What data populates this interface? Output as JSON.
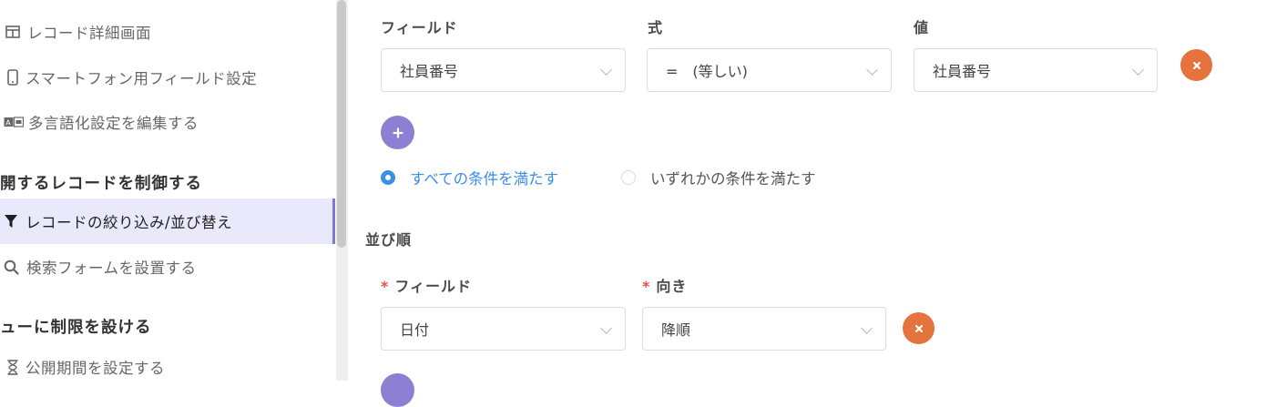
{
  "sidebar": {
    "items": [
      {
        "label": "レコード詳細画面",
        "icon": "columns-icon"
      },
      {
        "label": "スマートフォン用フィールド設定",
        "icon": "smartphone-icon"
      },
      {
        "label": "多言語化設定を編集する",
        "icon": "translate-icon"
      }
    ],
    "section1": "開するレコードを制御する",
    "section1_items": [
      {
        "label": "レコードの絞り込み/並び替え",
        "icon": "filter-icon",
        "active": true
      },
      {
        "label": "検索フォームを設置する",
        "icon": "search-icon"
      }
    ],
    "section2": "ューに制限を設ける",
    "section2_items": [
      {
        "label": "公開期間を設定する",
        "icon": "hourglass-icon"
      }
    ]
  },
  "filter": {
    "field_label": "フィールド",
    "operator_label": "式",
    "value_label": "値",
    "field_value": "社員番号",
    "operator_value": "=　(等しい)",
    "value_value": "社員番号",
    "match_all": "すべての条件を満たす",
    "match_any": "いずれかの条件を満たす",
    "selected_match": "all"
  },
  "sort": {
    "title": "並び順",
    "required_mark": "*",
    "field_label": "フィールド",
    "direction_label": "向き",
    "field_value": "日付",
    "direction_value": "降順"
  },
  "colors": {
    "accent_purple": "#8d7fd2",
    "remove_orange": "#e4733d",
    "radio_blue": "#3c8ee6",
    "active_bg": "#e9e9fb"
  }
}
